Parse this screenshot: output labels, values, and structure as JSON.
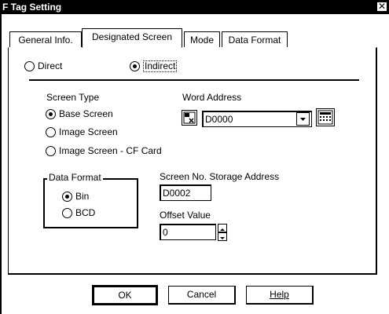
{
  "window": {
    "title": "F Tag Setting",
    "close_glyph": "✕"
  },
  "tabs": [
    {
      "label": "General Info."
    },
    {
      "label": "Designated Screen"
    },
    {
      "label": "Mode"
    },
    {
      "label": "Data Format"
    }
  ],
  "mode_options": {
    "direct": "Direct",
    "indirect": "Indirect",
    "selected": "Indirect"
  },
  "screen_type": {
    "label": "Screen Type",
    "options": [
      "Base Screen",
      "Image Screen",
      "Image Screen - CF Card"
    ],
    "selected": "Base Screen"
  },
  "word_address": {
    "label": "Word Address",
    "value": "D0000"
  },
  "data_format": {
    "label": "Data Format",
    "options": [
      "Bin",
      "BCD"
    ],
    "selected": "Bin"
  },
  "screen_no_storage": {
    "label": "Screen No. Storage Address",
    "value": "D0002"
  },
  "offset_value": {
    "label": "Offset Value",
    "value": "0"
  },
  "buttons": {
    "ok": "OK",
    "cancel": "Cancel",
    "help": "Help"
  },
  "icons": {
    "close": "close-icon",
    "word_address_picker": "address-picker-icon",
    "dropdown": "chevron-down-icon",
    "keypad": "keypad-icon",
    "spin_up": "spin-up-icon",
    "spin_down": "spin-down-icon"
  }
}
